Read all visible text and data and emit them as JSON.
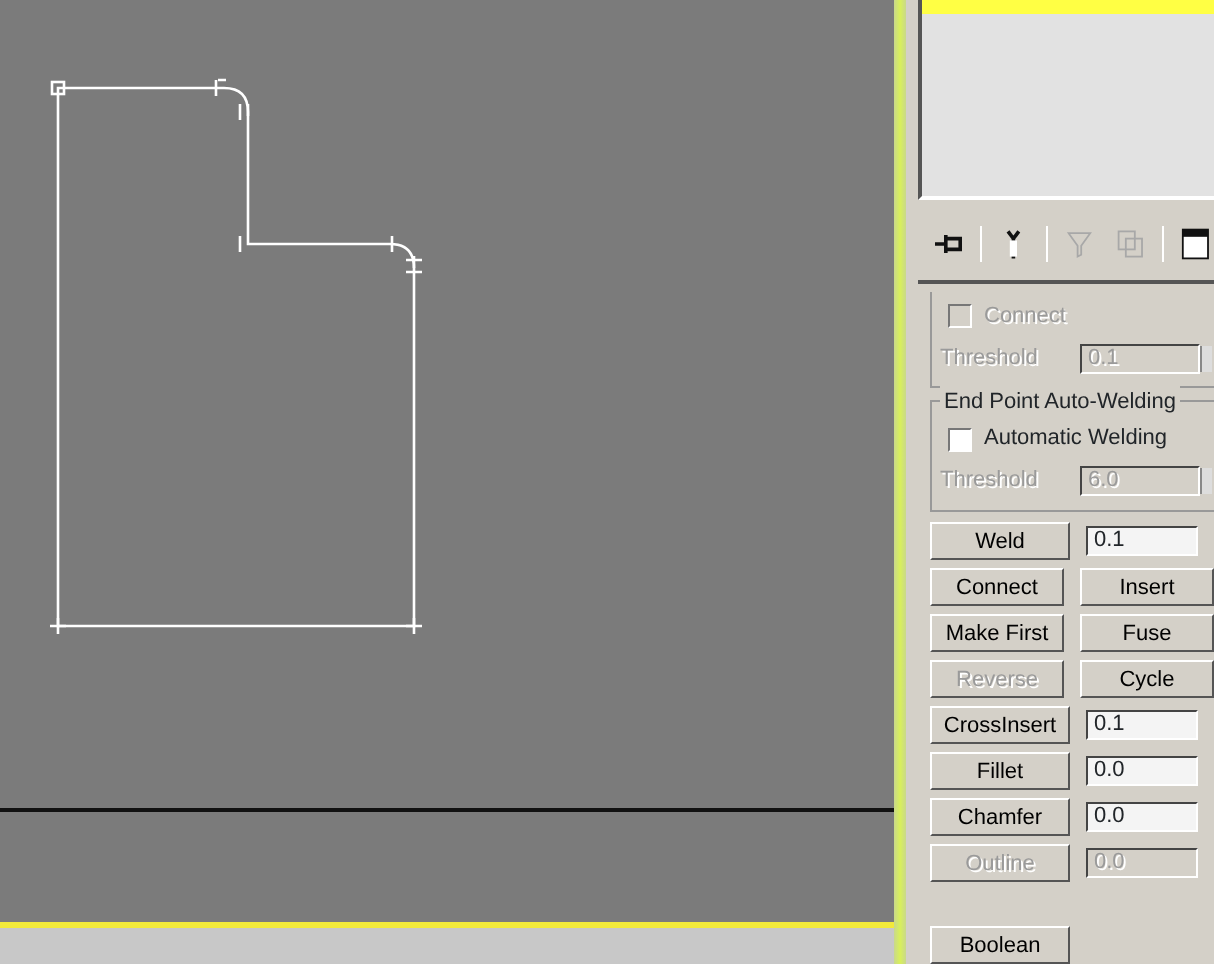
{
  "toolbar": [
    {
      "kind": "pin",
      "disabled": false
    },
    {
      "kind": "fork",
      "disabled": false
    },
    {
      "kind": "funnel",
      "disabled": true
    },
    {
      "kind": "copy",
      "disabled": true
    },
    {
      "kind": "panel",
      "disabled": false
    }
  ],
  "connect_group": {
    "checkbox": {
      "label": "Connect",
      "checked": false,
      "disabled": true
    },
    "threshold": {
      "label": "Threshold",
      "value": "0.1",
      "disabled": true
    }
  },
  "welding_group": {
    "title": "End Point Auto-Welding",
    "checkbox": {
      "label": "Automatic Welding",
      "checked": false,
      "disabled": false
    },
    "threshold": {
      "label": "Threshold",
      "value": "6.0",
      "disabled": true
    }
  },
  "operations": [
    {
      "kind": "button_field",
      "button": {
        "label": "Weld",
        "disabled": false
      },
      "field": {
        "value": "0.1",
        "disabled": false
      }
    },
    {
      "kind": "button_pair",
      "buttons": [
        {
          "label": "Connect",
          "disabled": false
        },
        {
          "label": "Insert",
          "disabled": false
        }
      ]
    },
    {
      "kind": "button_pair",
      "buttons": [
        {
          "label": "Make First",
          "disabled": false
        },
        {
          "label": "Fuse",
          "disabled": false
        }
      ]
    },
    {
      "kind": "button_pair",
      "buttons": [
        {
          "label": "Reverse",
          "disabled": true
        },
        {
          "label": "Cycle",
          "disabled": false
        }
      ]
    },
    {
      "kind": "button_field",
      "button": {
        "label": "CrossInsert",
        "disabled": false
      },
      "field": {
        "value": "0.1",
        "disabled": false
      }
    },
    {
      "kind": "button_field",
      "button": {
        "label": "Fillet",
        "disabled": false
      },
      "field": {
        "value": "0.0",
        "disabled": false
      }
    },
    {
      "kind": "button_field",
      "button": {
        "label": "Chamfer",
        "disabled": false
      },
      "field": {
        "value": "0.0",
        "disabled": false
      }
    },
    {
      "kind": "button_field",
      "button": {
        "label": "Outline",
        "disabled": true
      },
      "field": {
        "value": "0.0",
        "disabled": true
      }
    }
  ],
  "boolean_button": {
    "label": "Boolean",
    "disabled": false
  }
}
